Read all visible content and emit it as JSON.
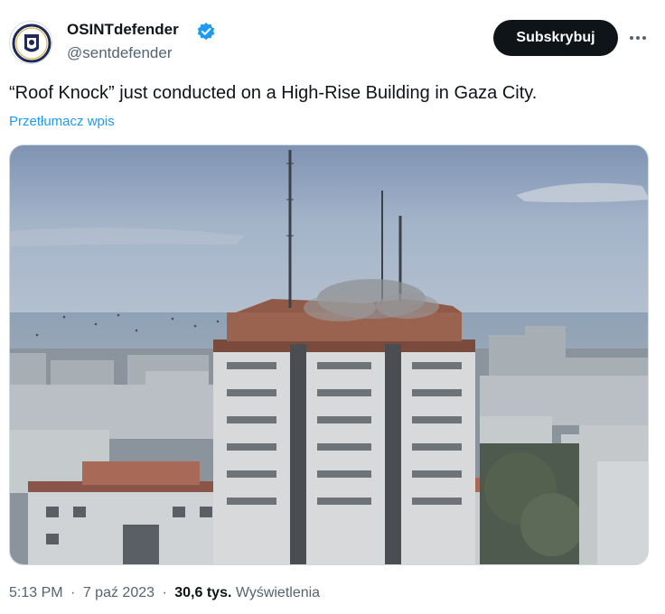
{
  "author": {
    "display_name": "OSINTdefender",
    "handle": "@sentdefender",
    "verified_icon": "verified-badge-icon",
    "avatar_icon": "osint-defender-logo"
  },
  "actions": {
    "subscribe_label": "Subskrybuj",
    "more_icon": "more-horizontal-icon"
  },
  "tweet": {
    "text": "“Roof Knock” just conducted on a High-Rise Building in Gaza City.",
    "translate_label": "Przetłumacz wpis"
  },
  "media": {
    "type": "photo",
    "subject": "high-rise-building-smoke"
  },
  "meta": {
    "time": "5:13 PM",
    "separator": "·",
    "date": "7 paź 2023",
    "views_count": "30,6 tys.",
    "views_label": "Wyświetlenia"
  },
  "colors": {
    "accent": "#1d9bf0",
    "button_dark": "#0f1419",
    "secondary_text": "#536471"
  }
}
